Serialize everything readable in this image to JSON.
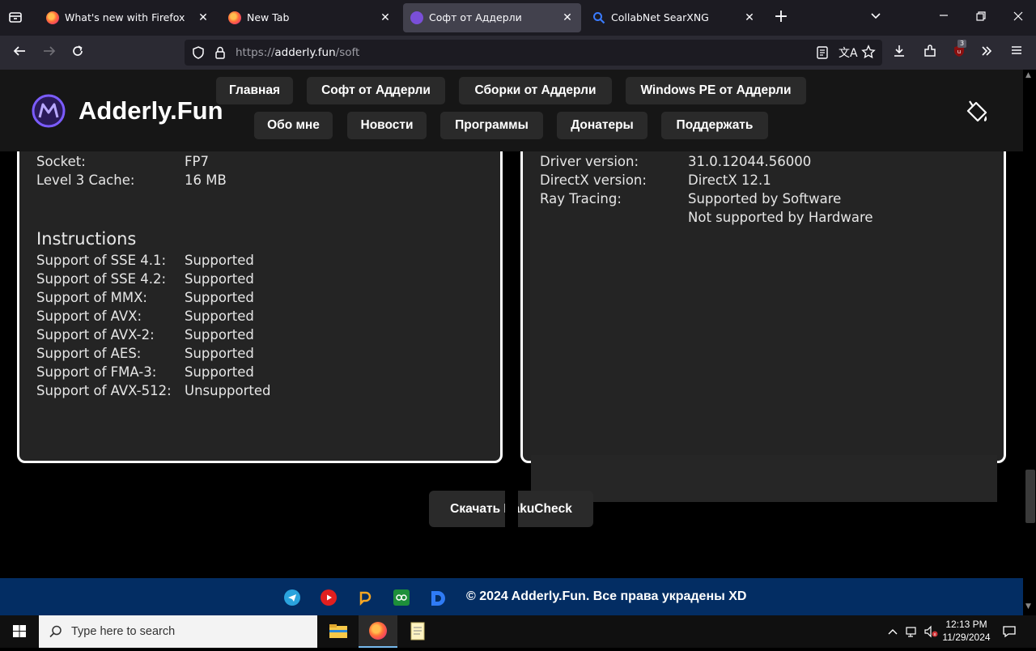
{
  "browser": {
    "tabs": [
      {
        "label": "What's new with Firefox",
        "active": false
      },
      {
        "label": "New Tab",
        "active": false
      },
      {
        "label": "Софт от Аддерли",
        "active": true
      },
      {
        "label": "CollabNet SearXNG",
        "active": false
      }
    ],
    "url_prefix": "https://",
    "url_host": "adderly.fun",
    "url_path": "/soft",
    "extension_badge": "3"
  },
  "site": {
    "name": "Adderly.Fun",
    "menu_row1": [
      "Главная",
      "Софт от Аддерли",
      "Сборки от Аддерли",
      "Windows PE от Аддерли"
    ],
    "menu_row2": [
      "Обо мне",
      "Новости",
      "Программы",
      "Донатеры",
      "Поддержать"
    ]
  },
  "cpu_card": {
    "top_rows": [
      {
        "label": "Socket:",
        "value": "FP7"
      },
      {
        "label": "Level 3 Cache:",
        "value": "16 MB"
      }
    ],
    "instructions_title": "Instructions",
    "instructions": [
      {
        "label": "Support of SSE 4.1:",
        "value": "Supported"
      },
      {
        "label": "Support of SSE 4.2:",
        "value": "Supported"
      },
      {
        "label": "Support of MMX:",
        "value": "Supported"
      },
      {
        "label": "Support of AVX:",
        "value": "Supported"
      },
      {
        "label": "Support of AVX-2:",
        "value": "Supported"
      },
      {
        "label": "Support of AES:",
        "value": "Supported"
      },
      {
        "label": "Support of FMA-3:",
        "value": "Supported"
      },
      {
        "label": "Support of AVX-512:",
        "value": "Unsupported"
      }
    ]
  },
  "gpu_card": {
    "rows": [
      {
        "label": "Driver version:",
        "value": "31.0.12044.56000"
      },
      {
        "label": "DirectX version:",
        "value": "DirectX 12.1"
      },
      {
        "label": "Ray Tracing:",
        "value": "Supported by Software"
      },
      {
        "label": "",
        "value": "Not supported by Hardware"
      }
    ]
  },
  "download_button": "Скачать HakuCheck",
  "footer_text": "© 2024 Adderly.Fun. Все права украдены XD",
  "taskbar": {
    "search_placeholder": "Type here to search",
    "time": "12:13 PM",
    "date": "11/29/2024"
  },
  "colors": {
    "accent": "#032d63",
    "card_bg": "#242424",
    "header_bg": "#161616"
  }
}
